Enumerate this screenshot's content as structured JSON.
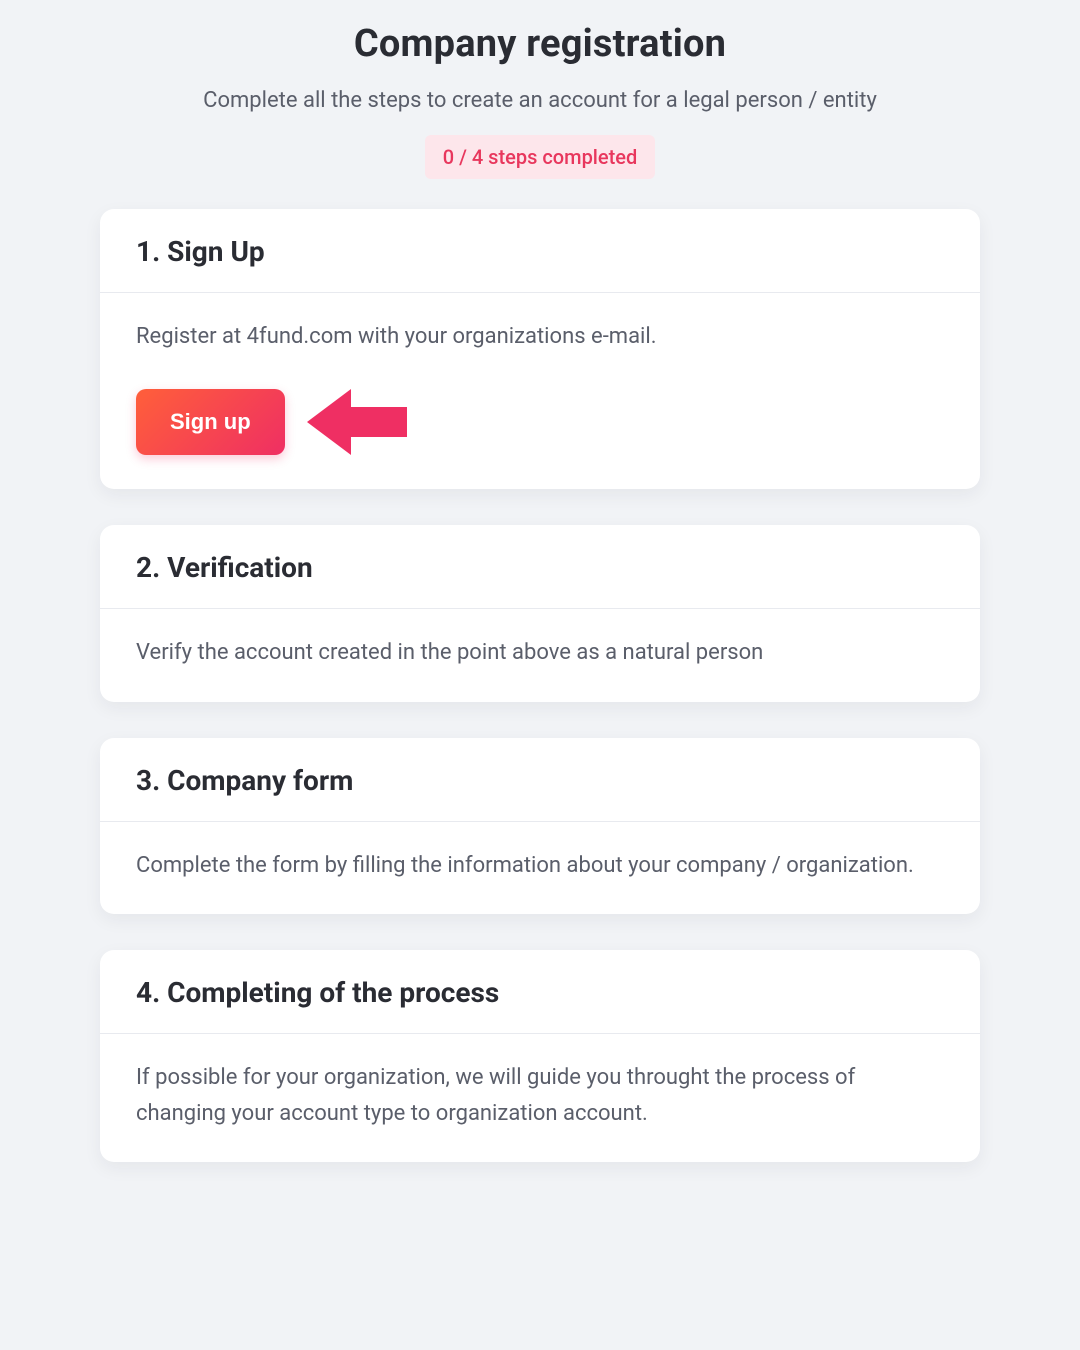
{
  "header": {
    "title": "Company registration",
    "subtitle": "Complete all the steps to create an account for a legal person / entity",
    "progress": "0 / 4 steps completed"
  },
  "steps": [
    {
      "title": "1. Sign Up",
      "text": "Register at 4fund.com with your organizations e-mail.",
      "button_label": "Sign up"
    },
    {
      "title": "2. Verification",
      "text": "Verify the account created in the point above as a natural person"
    },
    {
      "title": "3. Company form",
      "text": "Complete the form by filling the information about your company / organization."
    },
    {
      "title": "4. Completing of the process",
      "text": "If possible for your organization, we will guide you throught the process of changing your account type to organization account."
    }
  ],
  "colors": {
    "accent": "#ef2f63",
    "badge_bg": "#fde6eb"
  }
}
